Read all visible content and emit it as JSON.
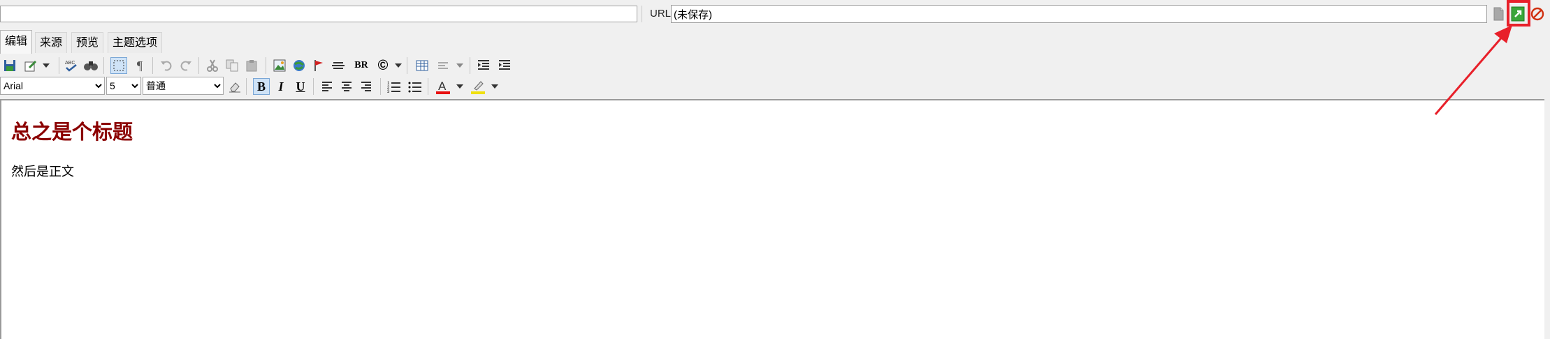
{
  "topbar": {
    "title_value": "",
    "url_label": "URL:",
    "url_value": "(未保存)"
  },
  "tabs": [
    {
      "label": "编辑",
      "active": true
    },
    {
      "label": "来源",
      "active": false
    },
    {
      "label": "预览",
      "active": false
    },
    {
      "label": "主题选项",
      "active": false
    }
  ],
  "format": {
    "font": "Arial",
    "size": "5",
    "paragraph": "普通",
    "bold_glyph": "B",
    "italic_glyph": "I",
    "underline_glyph": "U",
    "br_label": "BR",
    "copyright_glyph": "©",
    "pilcrow_glyph": "¶"
  },
  "document": {
    "heading": "总之是个标题",
    "body": "然后是正文"
  },
  "colors": {
    "heading": "#8b0000",
    "annotation": "#e8202a",
    "publish_green": "#2e9e2e",
    "cancel_red": "#d03010"
  },
  "icons": [
    "save-icon",
    "edit-icon",
    "spellcheck-icon",
    "find-icon",
    "select-all-icon",
    "pilcrow-icon",
    "undo-icon",
    "redo-icon",
    "cut-icon",
    "copy-icon",
    "paste-icon",
    "image-icon",
    "link-icon",
    "anchor-icon",
    "horizontal-rule-icon",
    "table-icon",
    "table-row-icon",
    "outdent-icon",
    "indent-icon",
    "eraser-icon",
    "align-left-icon",
    "align-center-icon",
    "align-right-icon",
    "ordered-list-icon",
    "unordered-list-icon",
    "font-color-icon",
    "highlight-icon",
    "document-icon",
    "publish-icon",
    "cancel-icon"
  ]
}
